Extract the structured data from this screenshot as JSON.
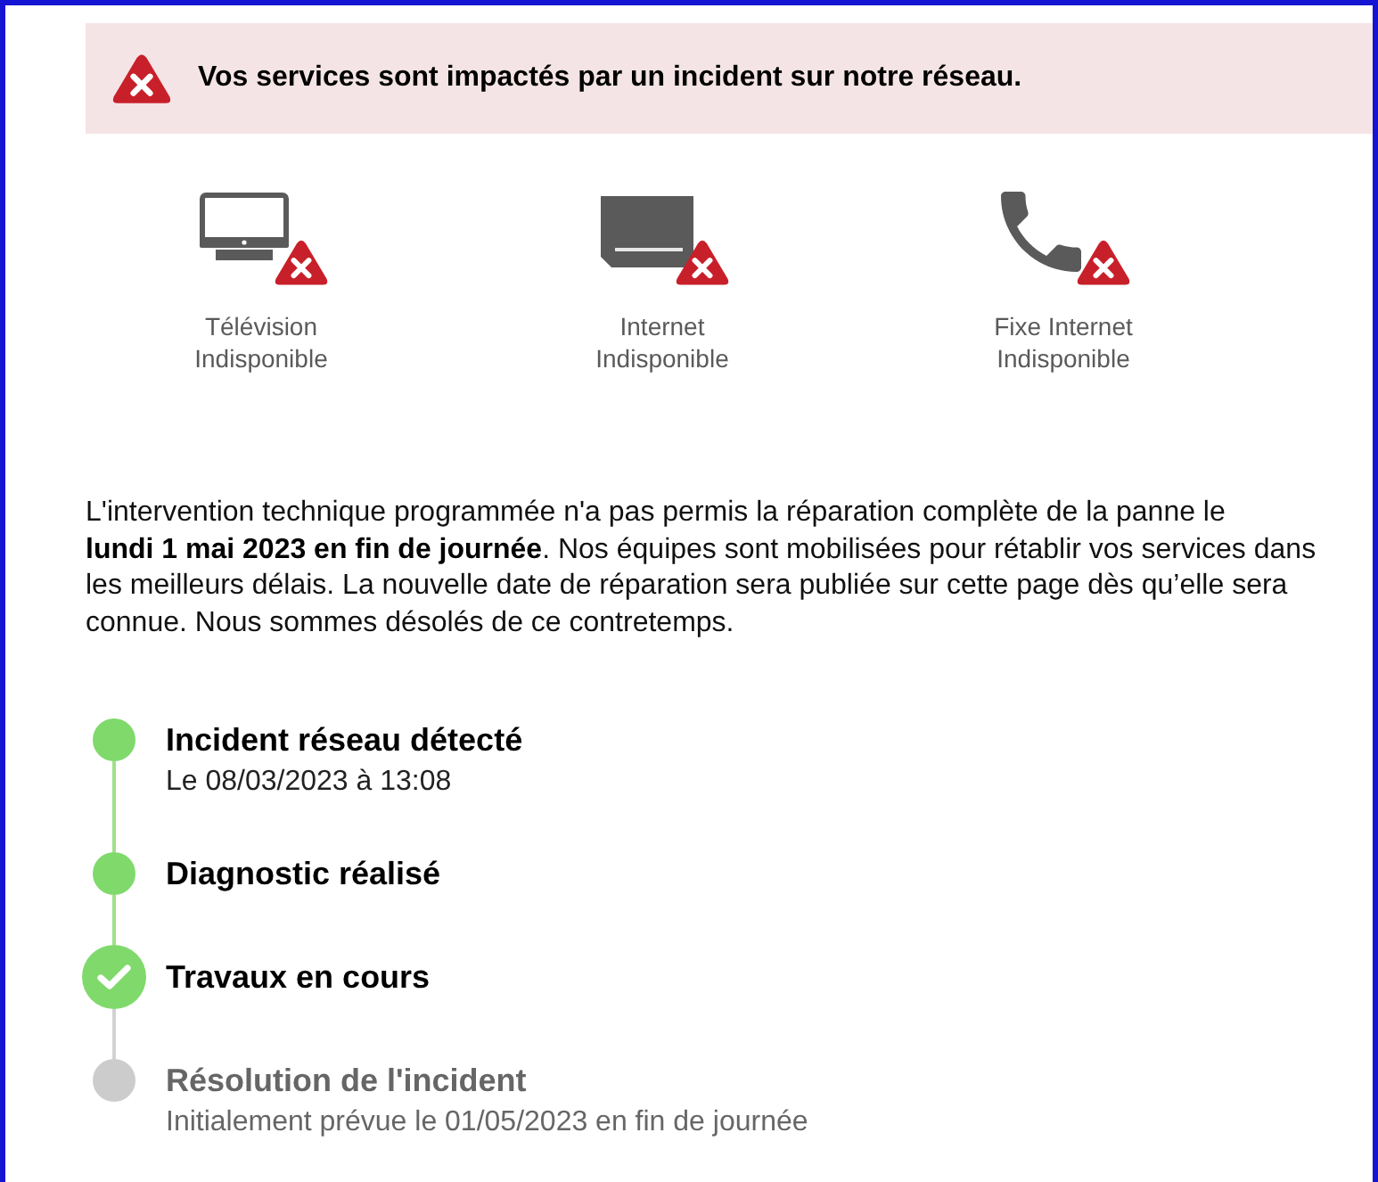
{
  "alert": {
    "message": "Vos services sont impactés par un incident sur notre réseau."
  },
  "services": [
    {
      "kind": "tv",
      "name": "Télévision",
      "status": "Indisponible",
      "available": false
    },
    {
      "kind": "box",
      "name": "Internet",
      "status": "Indisponible",
      "available": false
    },
    {
      "kind": "phone",
      "name": "Fixe Internet",
      "status": "Indisponible",
      "available": false
    }
  ],
  "notice": "L'intervention technique programmée n'a pas permis la réparation complète de la panne le **lundi 1 mai 2023 en fin de journée**. Nos équipes sont mobilisées pour rétablir vos services dans les meilleurs délais. La nouvelle date de réparation sera publiée sur cette page dès qu’elle sera connue. Nous sommes désolés de ce contretemps.",
  "timeline": [
    {
      "title": "Incident réseau détecté",
      "detail": "Le 08/03/2023 à 13:08",
      "completed": true,
      "current": false
    },
    {
      "title": "Diagnostic réalisé",
      "completed": true,
      "current": false
    },
    {
      "title": "Travaux en cours",
      "completed": true,
      "current": true
    },
    {
      "title": "Résolution de l'incident",
      "detail": "Initialement prévue le 01/05/2023 en fin de journée",
      "completed": false,
      "current": false
    }
  ]
}
